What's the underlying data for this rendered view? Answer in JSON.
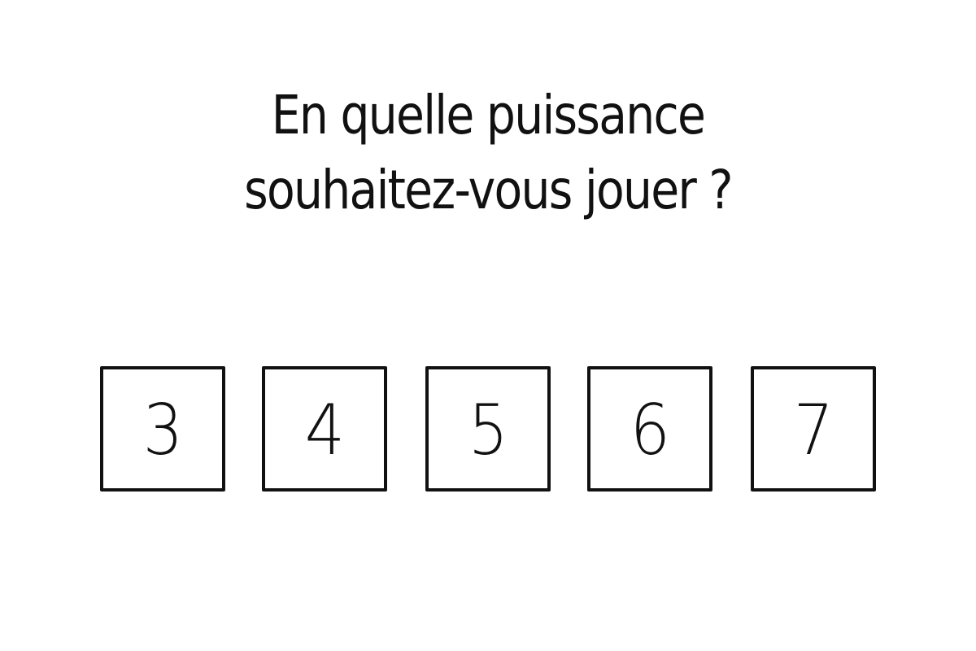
{
  "question": {
    "line1": "En quelle puissance",
    "line2": "souhaitez-vous jouer ?"
  },
  "choices": [
    {
      "label": "3"
    },
    {
      "label": "4"
    },
    {
      "label": "5"
    },
    {
      "label": "6"
    },
    {
      "label": "7"
    }
  ]
}
